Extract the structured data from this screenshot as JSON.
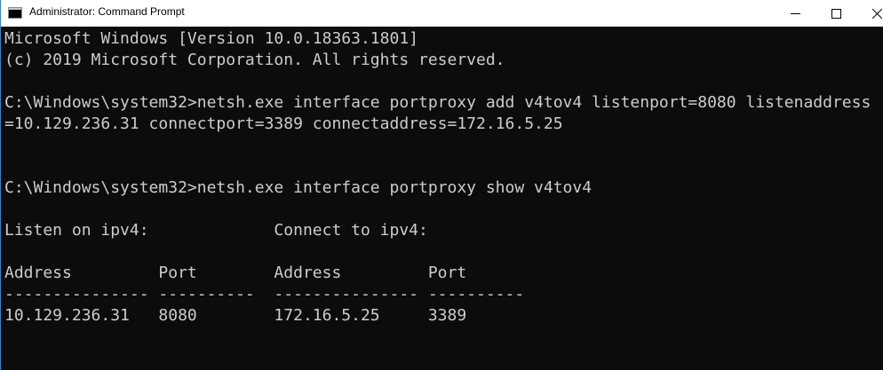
{
  "window": {
    "title": "Administrator: Command Prompt",
    "icon": "cmd-icon"
  },
  "title_buttons": {
    "minimize": "minimize-icon",
    "maximize": "maximize-icon",
    "close": "close-icon"
  },
  "colors": {
    "console_bg": "#0c0c0c",
    "console_text": "#cccccc",
    "titlebar_bg": "#ffffff",
    "accent": "#2b88d8"
  },
  "console": {
    "lines": [
      "Microsoft Windows [Version 10.0.18363.1801]",
      "(c) 2019 Microsoft Corporation. All rights reserved.",
      "",
      "C:\\Windows\\system32>netsh.exe interface portproxy add v4tov4 listenport=8080 listenaddress",
      "=10.129.236.31 connectport=3389 connectaddress=172.16.5.25",
      "",
      "",
      "C:\\Windows\\system32>netsh.exe interface portproxy show v4tov4",
      "",
      "Listen on ipv4:             Connect to ipv4:",
      "",
      "Address         Port        Address         Port",
      "--------------- ----------  --------------- ----------",
      "10.129.236.31   8080        172.16.5.25     3389",
      "",
      ""
    ]
  }
}
